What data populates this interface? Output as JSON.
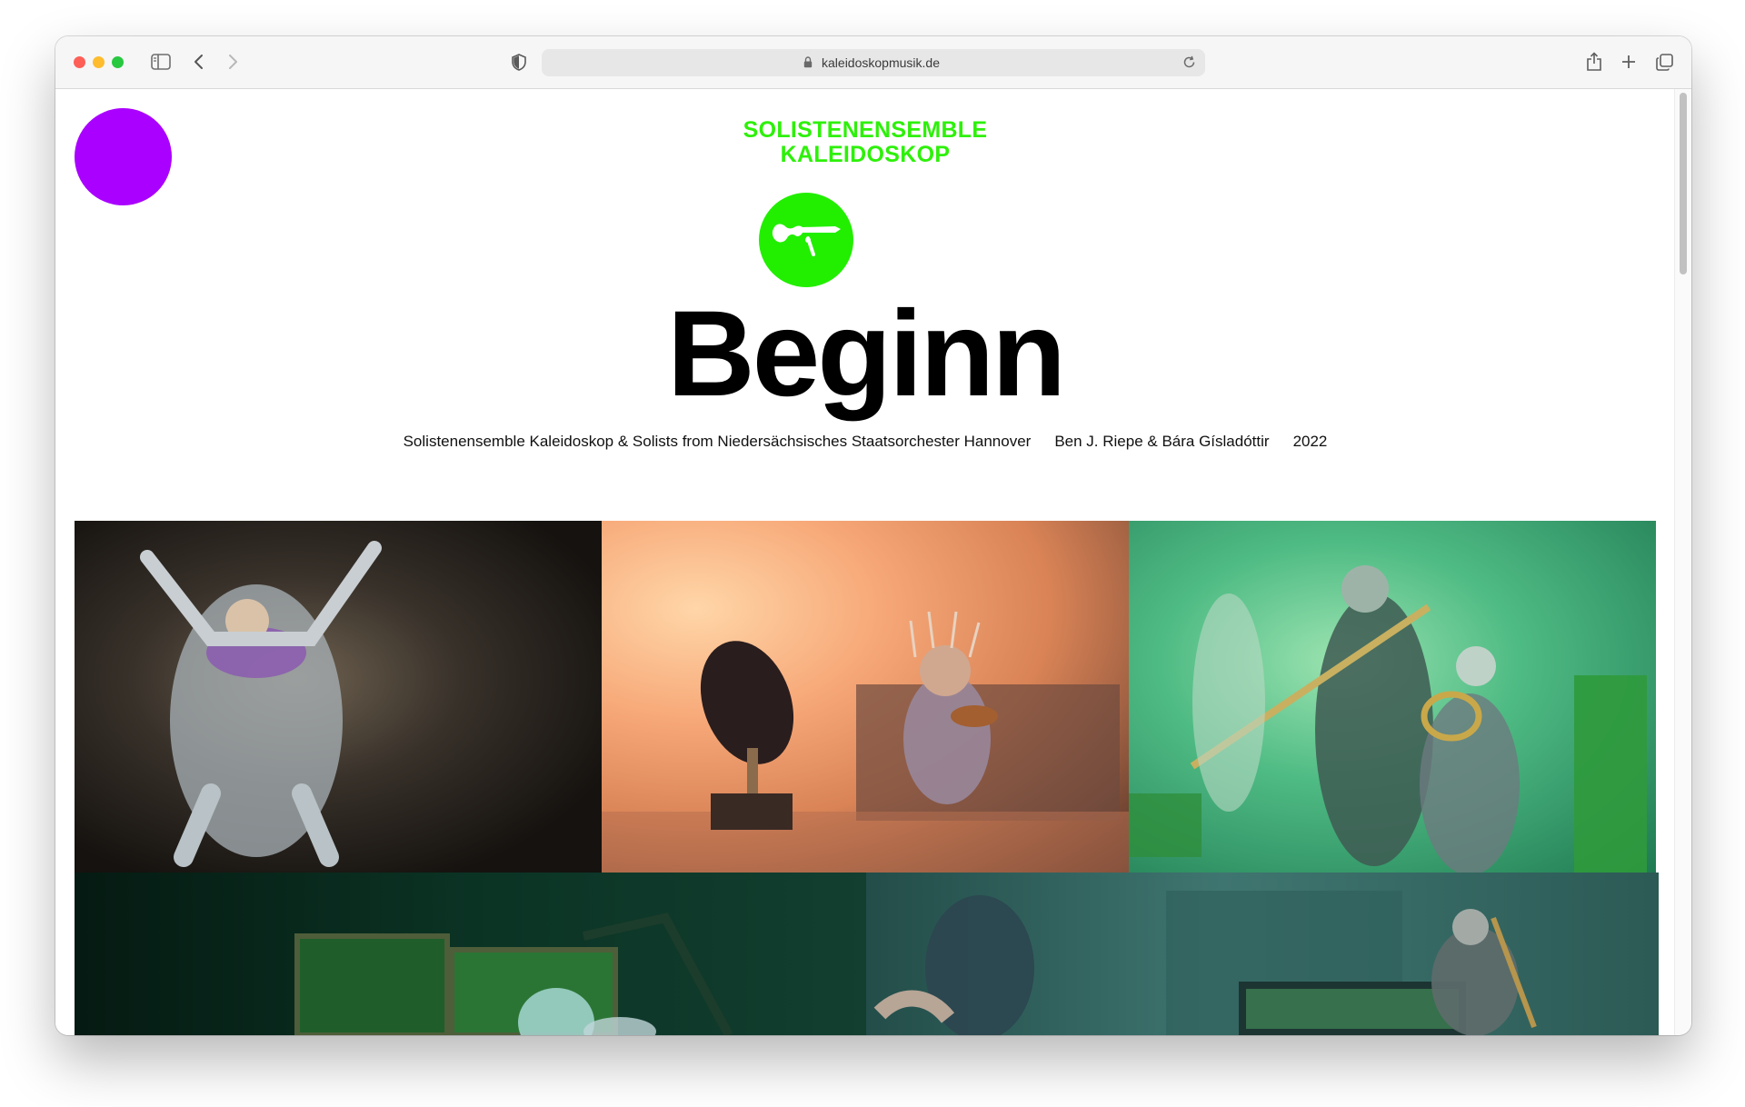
{
  "browser": {
    "url": "kaleidoskopmusik.de"
  },
  "site": {
    "brand_line1": "SOLISTENENSEMBLE",
    "brand_line2": "KALEIDOSKOP",
    "menu_color": "#aa00ff",
    "accent_color": "#2ef00a",
    "instrument_icon": "violin-icon"
  },
  "production": {
    "title": "Beginn",
    "performers": "Solistenensemble Kaleidoskop & Solists from Niedersächsisches Staatsorchester Hannover",
    "directors": "Ben J. Riepe & Bára Gísladóttir",
    "year": "2022"
  }
}
